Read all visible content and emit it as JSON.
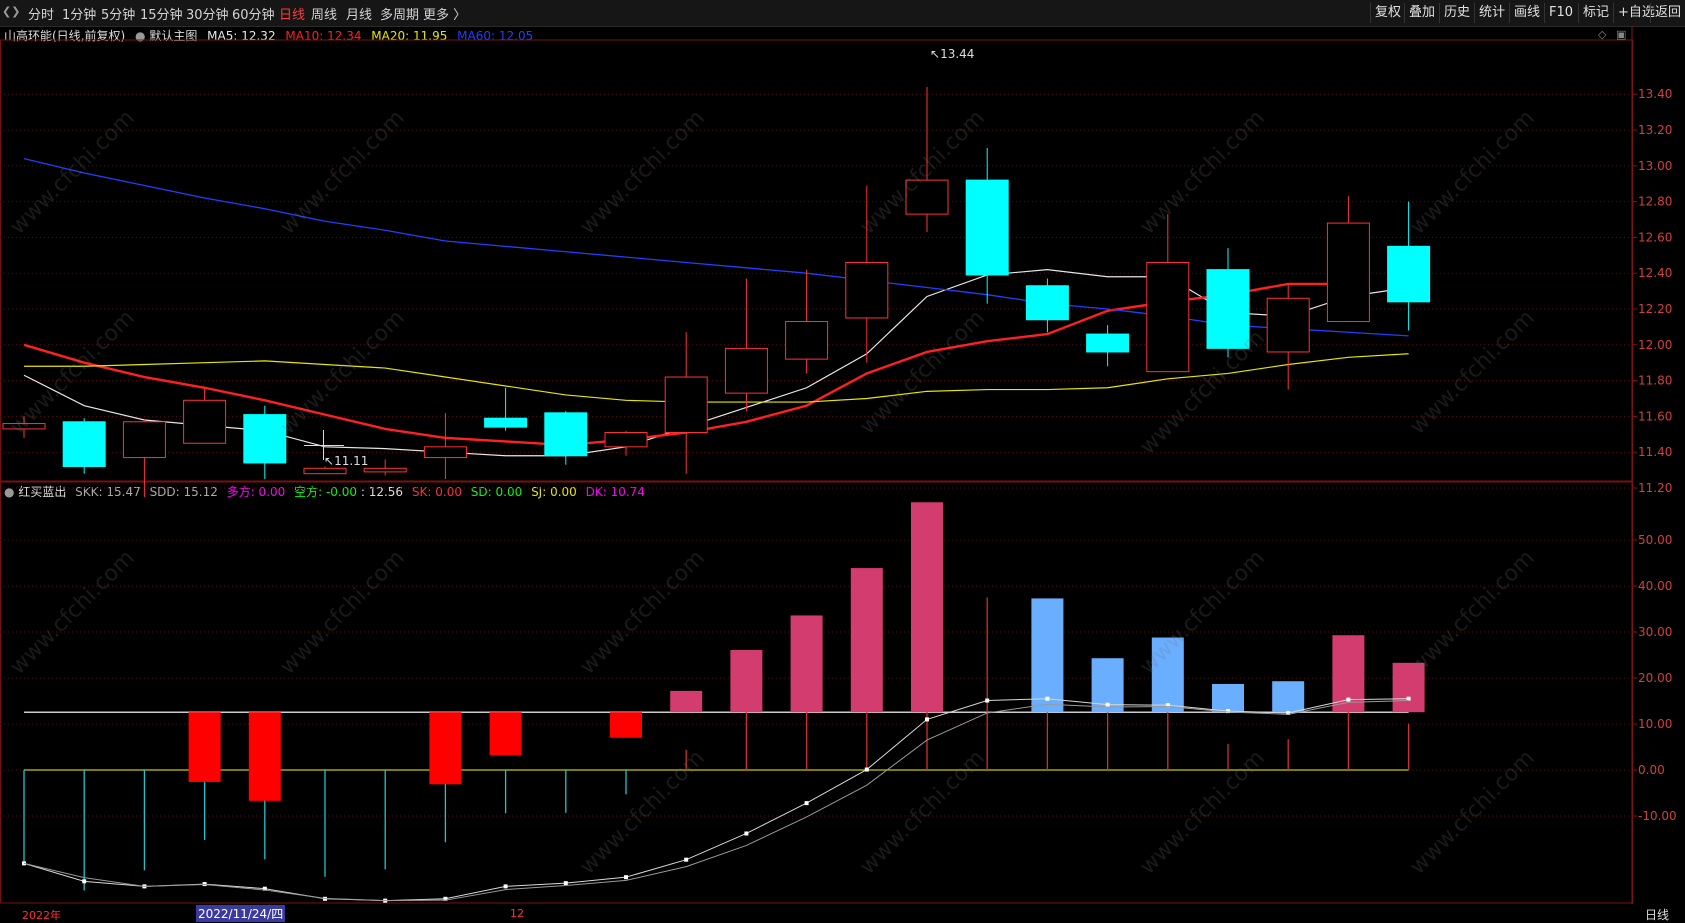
{
  "toolbar": {
    "periods": [
      "分时",
      "1分钟",
      "5分钟",
      "15分钟",
      "30分钟",
      "60分钟",
      "日线",
      "周线",
      "月线",
      "多周期",
      "更多 〉"
    ],
    "active_period": "日线",
    "right_buttons": [
      "复权",
      "叠加",
      "历史",
      "统计",
      "画线",
      "F10",
      "标记",
      "+自选",
      "返回"
    ]
  },
  "main_info": {
    "title": "山高环能(日线,前复权)",
    "main_chart_label": "默认主图",
    "ma5": "MA5: 12.32",
    "ma10": "MA10: 12.34",
    "ma20": "MA20: 11.95",
    "ma60": "MA60: 12.05"
  },
  "indicator_info": {
    "name": "红买蓝出",
    "skk": "SKK: 15.47",
    "sdd": "SDD: 15.12",
    "duofang": "多方: 0.00",
    "kongfang": "空方: -0.00",
    "val": ": 12.56",
    "sk": "SK: 0.00",
    "sd": "SD: 0.00",
    "sj": "SJ: 0.00",
    "dk": "DK: 10.74"
  },
  "annotations": {
    "high": "13.44",
    "low": "11.11"
  },
  "bottom": {
    "year": "2022年",
    "date": "2022/11/24/四",
    "month": "12",
    "period_label": "日线"
  },
  "watermark": "www.cfchi.com",
  "colors": {
    "up": "#ff3333",
    "down": "#00ffff",
    "ma5": "#e6e6e6",
    "ma10": "#ff2020",
    "ma20": "#e6e600",
    "ma60": "#2040ff",
    "pink": "#d23c6e",
    "lightblue": "#6aaeff"
  },
  "chart_data": [
    {
      "type": "candlestick",
      "title": "山高环能(日线,前复权)",
      "ylim": [
        11.0,
        13.6
      ],
      "y_ticks": [
        "13.40",
        "13.20",
        "13.00",
        "12.80",
        "12.60",
        "12.40",
        "12.20",
        "12.00",
        "11.80",
        "11.60",
        "11.40",
        "11.20"
      ],
      "candles": [
        {
          "o": 11.53,
          "c": 11.56,
          "h": 11.6,
          "l": 11.48
        },
        {
          "o": 11.57,
          "c": 11.32,
          "h": 11.59,
          "l": 11.28
        },
        {
          "o": 11.37,
          "c": 11.57,
          "h": 11.58,
          "l": 11.15
        },
        {
          "o": 11.45,
          "c": 11.69,
          "h": 11.76,
          "l": 11.45
        },
        {
          "o": 11.61,
          "c": 11.34,
          "h": 11.66,
          "l": 11.25
        },
        {
          "o": 11.28,
          "c": 11.31,
          "h": 11.32,
          "l": 11.28
        },
        {
          "o": 11.29,
          "c": 11.31,
          "h": 11.36,
          "l": 11.27
        },
        {
          "o": 11.37,
          "c": 11.43,
          "h": 11.62,
          "l": 11.25
        },
        {
          "o": 11.59,
          "c": 11.54,
          "h": 11.76,
          "l": 11.52
        },
        {
          "o": 11.62,
          "c": 11.38,
          "h": 11.63,
          "l": 11.33
        },
        {
          "o": 11.43,
          "c": 11.51,
          "h": 11.52,
          "l": 11.38
        },
        {
          "o": 11.51,
          "c": 11.82,
          "h": 12.07,
          "l": 11.28
        },
        {
          "o": 11.73,
          "c": 11.98,
          "h": 12.37,
          "l": 11.63
        },
        {
          "o": 11.92,
          "c": 12.13,
          "h": 12.42,
          "l": 11.84
        },
        {
          "o": 12.15,
          "c": 12.46,
          "h": 12.89,
          "l": 11.9
        },
        {
          "o": 12.73,
          "c": 12.92,
          "h": 13.44,
          "l": 12.63
        },
        {
          "o": 12.92,
          "c": 12.39,
          "h": 13.1,
          "l": 12.23
        },
        {
          "o": 12.33,
          "c": 12.14,
          "h": 12.37,
          "l": 12.07
        },
        {
          "o": 12.06,
          "c": 11.96,
          "h": 12.11,
          "l": 11.88
        },
        {
          "o": 11.85,
          "c": 12.46,
          "h": 12.73,
          "l": 11.85
        },
        {
          "o": 12.42,
          "c": 11.98,
          "h": 12.54,
          "l": 11.93
        },
        {
          "o": 11.96,
          "c": 12.26,
          "h": 12.34,
          "l": 11.75
        },
        {
          "o": 12.13,
          "c": 12.68,
          "h": 12.83,
          "l": 12.13
        },
        {
          "o": 12.55,
          "c": 12.24,
          "h": 12.8,
          "l": 12.08
        }
      ],
      "series": [
        {
          "name": "MA5",
          "values": [
            11.83,
            11.66,
            11.58,
            11.55,
            11.52,
            11.43,
            11.42,
            11.4,
            11.38,
            11.38,
            11.43,
            11.54,
            11.65,
            11.76,
            11.95,
            12.27,
            12.39,
            12.42,
            12.38,
            12.38,
            12.18,
            12.16,
            12.27,
            12.32
          ]
        },
        {
          "name": "MA10",
          "values": [
            12.0,
            11.9,
            11.82,
            11.76,
            11.69,
            11.61,
            11.53,
            11.48,
            11.46,
            11.44,
            11.47,
            11.51,
            11.57,
            11.66,
            11.84,
            11.96,
            12.02,
            12.06,
            12.19,
            12.24,
            12.28,
            12.34,
            12.34
          ]
        },
        {
          "name": "MA20",
          "values": [
            11.88,
            11.88,
            11.89,
            11.9,
            11.91,
            11.89,
            11.87,
            11.82,
            11.77,
            11.72,
            11.69,
            11.68,
            11.68,
            11.68,
            11.7,
            11.74,
            11.75,
            11.75,
            11.76,
            11.81,
            11.84,
            11.89,
            11.93,
            11.95
          ]
        },
        {
          "name": "MA60",
          "values": [
            13.04,
            12.96,
            12.89,
            12.82,
            12.76,
            12.69,
            12.64,
            12.58,
            12.55,
            12.52,
            12.49,
            12.46,
            12.43,
            12.4,
            12.36,
            12.32,
            12.28,
            12.23,
            12.2,
            12.16,
            12.11,
            12.09,
            12.07,
            12.05
          ]
        }
      ]
    },
    {
      "type": "bar",
      "title": "红买蓝出",
      "ylim": [
        -30,
        62
      ],
      "y_ticks": [
        "50.00",
        "40.00",
        "30.00",
        "20.00",
        "10.00",
        "0.00",
        "-10.00"
      ],
      "baseline": 12.56,
      "bars": [
        {
          "i": 3,
          "value": -2.6,
          "color": "red"
        },
        {
          "i": 4,
          "value": -6.7,
          "color": "red"
        },
        {
          "i": 7,
          "value": -3.1,
          "color": "red"
        },
        {
          "i": 8,
          "value": 3.2,
          "color": "red"
        },
        {
          "i": 10,
          "value": 7.0,
          "color": "red"
        },
        {
          "i": 11,
          "value": 17.2,
          "color": "pink"
        },
        {
          "i": 12,
          "value": 26.1,
          "color": "pink"
        },
        {
          "i": 13,
          "value": 33.6,
          "color": "pink"
        },
        {
          "i": 14,
          "value": 43.9,
          "color": "pink"
        },
        {
          "i": 15,
          "value": 58.2,
          "color": "pink"
        },
        {
          "i": 17,
          "value": 37.3,
          "color": "lightblue"
        },
        {
          "i": 18,
          "value": 24.3,
          "color": "lightblue"
        },
        {
          "i": 19,
          "value": 28.8,
          "color": "lightblue"
        },
        {
          "i": 20,
          "value": 18.7,
          "color": "lightblue"
        },
        {
          "i": 21,
          "value": 19.3,
          "color": "lightblue"
        },
        {
          "i": 22,
          "value": 29.3,
          "color": "pink"
        },
        {
          "i": 23,
          "value": 23.3,
          "color": "pink"
        }
      ],
      "sticks": [
        {
          "i": 0,
          "value": -20.2,
          "color": "cyan"
        },
        {
          "i": 1,
          "value": -26.2,
          "color": "cyan"
        },
        {
          "i": 2,
          "value": -21.8,
          "color": "cyan"
        },
        {
          "i": 3,
          "value": -15.2,
          "color": "cyan"
        },
        {
          "i": 4,
          "value": -19.4,
          "color": "cyan"
        },
        {
          "i": 5,
          "value": -23.2,
          "color": "cyan"
        },
        {
          "i": 6,
          "value": -21.6,
          "color": "cyan"
        },
        {
          "i": 7,
          "value": -15.7,
          "color": "cyan"
        },
        {
          "i": 8,
          "value": -9.4,
          "color": "cyan"
        },
        {
          "i": 9,
          "value": -9.3,
          "color": "cyan"
        },
        {
          "i": 10,
          "value": -5.3,
          "color": "cyan"
        },
        {
          "i": 11,
          "value": 4.4,
          "color": "red"
        },
        {
          "i": 12,
          "value": 12.6,
          "color": "red"
        },
        {
          "i": 13,
          "value": 12.6,
          "color": "red"
        },
        {
          "i": 14,
          "value": 13.0,
          "color": "red"
        },
        {
          "i": 15,
          "value": 22.0,
          "color": "red"
        },
        {
          "i": 16,
          "value": 37.5,
          "color": "red"
        },
        {
          "i": 17,
          "value": 12.6,
          "color": "red"
        },
        {
          "i": 18,
          "value": 12.6,
          "color": "red"
        },
        {
          "i": 19,
          "value": 12.6,
          "color": "red"
        },
        {
          "i": 20,
          "value": 5.7,
          "color": "red"
        },
        {
          "i": 21,
          "value": 6.7,
          "color": "red"
        },
        {
          "i": 22,
          "value": 12.6,
          "color": "red"
        },
        {
          "i": 23,
          "value": 10.1,
          "color": "red"
        }
      ],
      "series": [
        {
          "name": "SKK",
          "values": [
            -20.3,
            -24.2,
            -25.3,
            -24.8,
            -25.8,
            -28.0,
            -28.4,
            -28.0,
            -25.3,
            -24.6,
            -23.3,
            -19.5,
            -13.8,
            -7.2,
            0.1,
            11.0,
            15.1,
            15.5,
            14.2,
            14.1,
            12.8,
            12.4,
            15.3,
            15.5
          ]
        },
        {
          "name": "SDD",
          "values": [
            -20.3,
            -23.4,
            -25.3,
            -24.9,
            -26.1,
            -27.9,
            -28.4,
            -28.3,
            -26.0,
            -25.1,
            -24.0,
            -21.0,
            -16.4,
            -10.2,
            -3.3,
            6.5,
            12.4,
            14.3,
            13.7,
            13.8,
            12.6,
            12.1,
            14.7,
            15.1
          ]
        }
      ]
    }
  ]
}
